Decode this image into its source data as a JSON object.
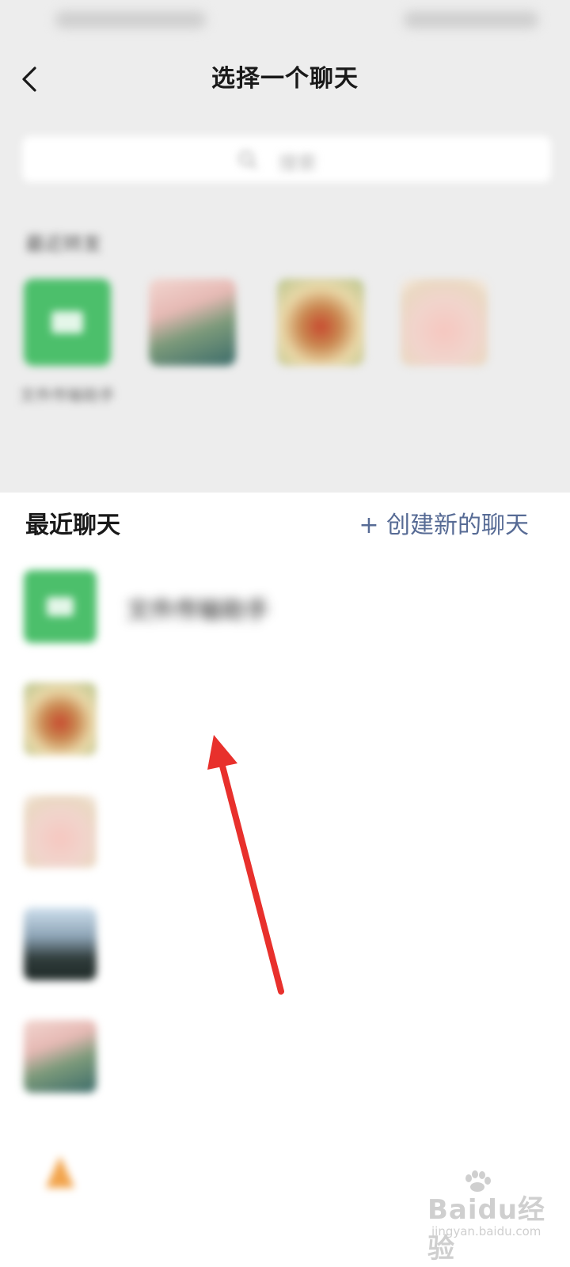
{
  "status_bar": {
    "left_text": "",
    "right_text": ""
  },
  "header": {
    "title": "选择一个聊天"
  },
  "search": {
    "placeholder": "搜索"
  },
  "frequent": {
    "label": "最近转发",
    "items": [
      {
        "name_line1": "文件传输助手",
        "name_line2": ""
      },
      {
        "name_line1": "",
        "name_line2": ""
      },
      {
        "name_line1": "",
        "name_line2": ""
      },
      {
        "name_line1": "",
        "name_line2": ""
      }
    ]
  },
  "recent": {
    "title": "最近聊天",
    "create_new": "+ 创建新的聊天"
  },
  "chats": [
    {
      "name": "文件传输助手"
    },
    {
      "name": ""
    },
    {
      "name": ""
    },
    {
      "name": ""
    },
    {
      "name": ""
    },
    {
      "name": ""
    }
  ],
  "watermark": {
    "brand": "Baidu经验",
    "url": "jingyan.baidu.com"
  },
  "colors": {
    "accent_link": "#576b95",
    "wechat_green": "#4cbf6b",
    "annotation_arrow": "#e8302c"
  }
}
